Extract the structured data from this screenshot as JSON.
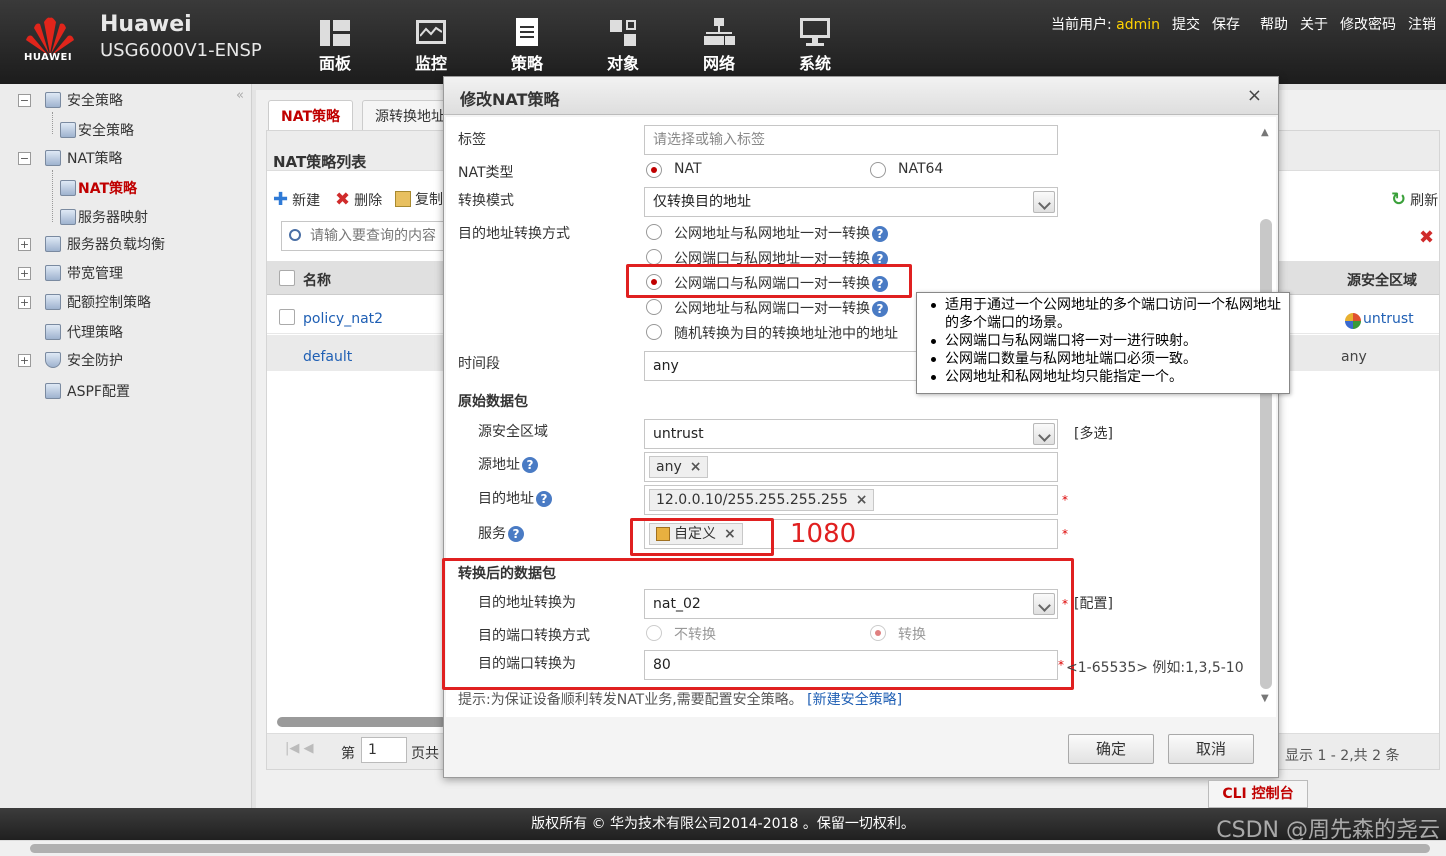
{
  "header": {
    "brand": "Huawei",
    "logo_text": "HUAWEI",
    "model": "USG6000V1-ENSP",
    "nav": [
      {
        "label": "面板",
        "icon": "dashboard-icon"
      },
      {
        "label": "监控",
        "icon": "monitor-icon"
      },
      {
        "label": "策略",
        "icon": "policy-icon"
      },
      {
        "label": "对象",
        "icon": "object-icon"
      },
      {
        "label": "网络",
        "icon": "network-icon"
      },
      {
        "label": "系统",
        "icon": "system-icon"
      }
    ],
    "user_label": "当前用户:",
    "user": "admin",
    "links": [
      "提交",
      "保存",
      "帮助",
      "关于",
      "修改密码",
      "注销"
    ]
  },
  "sidebar": {
    "collapse": "«",
    "items": [
      {
        "label": "安全策略",
        "toggle": "−"
      },
      {
        "label": "安全策略"
      },
      {
        "label": "NAT策略",
        "toggle": "−"
      },
      {
        "label": "NAT策略",
        "active": true
      },
      {
        "label": "服务器映射"
      },
      {
        "label": "服务器负载均衡",
        "toggle": "+"
      },
      {
        "label": "带宽管理",
        "toggle": "+"
      },
      {
        "label": "配额控制策略",
        "toggle": "+"
      },
      {
        "label": "代理策略"
      },
      {
        "label": "安全防护",
        "toggle": "+"
      },
      {
        "label": "ASPF配置"
      }
    ]
  },
  "main": {
    "tabs": [
      "NAT策略",
      "源转换地址"
    ],
    "panel_title": "NAT策略列表",
    "toolbar": {
      "new": "新建",
      "delete": "删除",
      "copy": "复制",
      "refresh": "刷新"
    },
    "search_placeholder": "请输入要查询的内容",
    "columns": {
      "name": "名称",
      "src_zone": "源安全区域"
    },
    "rows": [
      {
        "name": "policy_nat2",
        "src_zone": "untrust"
      },
      {
        "name": "default",
        "src_zone": "any"
      }
    ],
    "pager": {
      "page_label": "第",
      "page": "1",
      "page_suffix": "页共",
      "summary": "显示 1 - 2,共 2 条"
    }
  },
  "dialog": {
    "title": "修改NAT策略",
    "close": "×",
    "tag_label": "标签",
    "tag_placeholder": "请选择或输入标签",
    "nat_type_label": "NAT类型",
    "nat_type_options": [
      "NAT",
      "NAT64"
    ],
    "conv_mode_label": "转换模式",
    "conv_mode_value": "仅转换目的地址",
    "dst_method_label": "目的地址转换方式",
    "dst_methods": [
      "公网地址与私网地址一对一转换",
      "公网端口与私网地址一对一转换",
      "公网端口与私网端口一对一转换",
      "公网地址与私网端口一对一转换",
      "随机转换为目的转换地址池中的地址"
    ],
    "time_label": "时间段",
    "time_value": "any",
    "orig_section": "原始数据包",
    "src_zone_label": "源安全区域",
    "src_zone_value": "untrust",
    "multi_select": "[多选]",
    "src_addr_label": "源地址",
    "src_addr_chip": "any",
    "dst_addr_label": "目的地址",
    "dst_addr_chip": "12.0.0.10/255.255.255.255",
    "service_label": "服务",
    "service_chip": "自定义",
    "annotation": "1080",
    "after_section": "转换后的数据包",
    "dst_to_label": "目的地址转换为",
    "dst_to_value": "nat_02",
    "config_link": "[配置]",
    "port_method_label": "目的端口转换方式",
    "port_methods": [
      "不转换",
      "转换"
    ],
    "port_to_label": "目的端口转换为",
    "port_to_value": "80",
    "port_hint": "<1-65535> 例如:1,3,5-10",
    "tip_text": "提示:为保证设备顺利转发NAT业务,需要配置安全策略。",
    "tip_link": "[新建安全策略]",
    "ok": "确定",
    "cancel": "取消"
  },
  "tooltip": {
    "lines": [
      "适用于通过一个公网地址的多个端口访问一个私网地址的多个端口的场景。",
      "公网端口与私网端口将一对一进行映射。",
      "公网端口数量与私网地址端口必须一致。",
      "公网地址和私网地址均只能指定一个。"
    ]
  },
  "footer": {
    "copyright": "版权所有 © 华为技术有限公司2014-2018 。保留一切权利。",
    "cli": "CLI 控制台",
    "watermark": "CSDN @周先森的尧云"
  }
}
